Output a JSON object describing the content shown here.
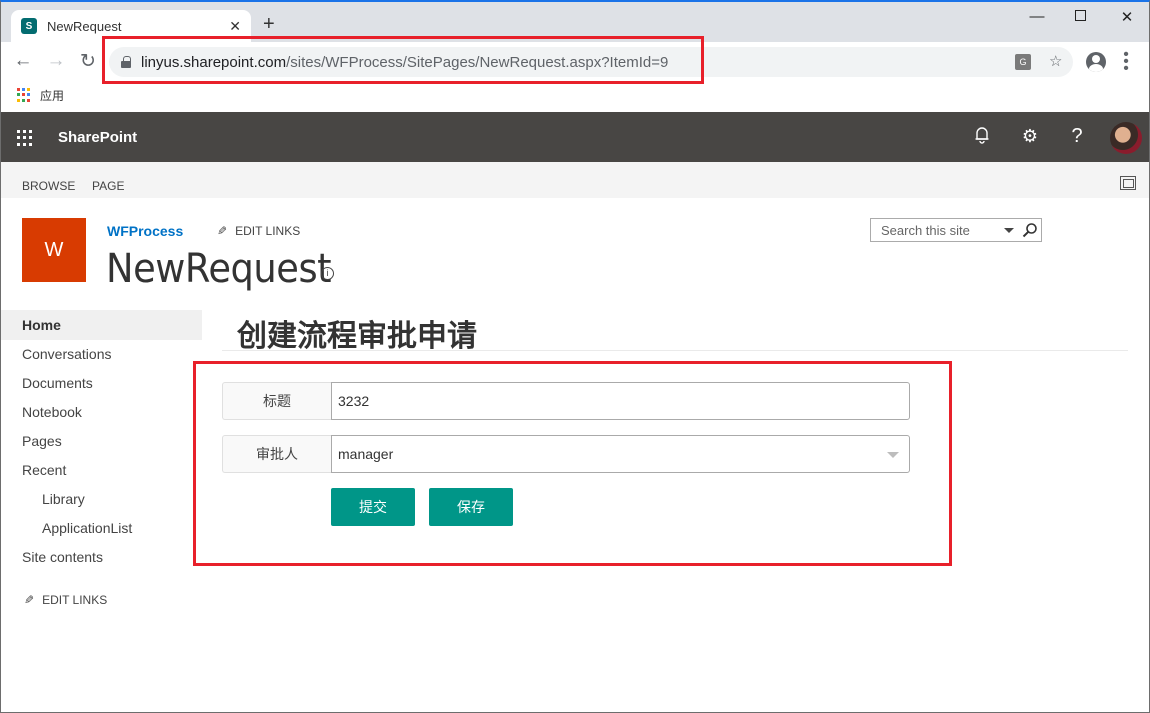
{
  "browser": {
    "tab_title": "NewRequest",
    "tab_close": "✕",
    "new_tab": "+",
    "url_host": "linyus.sharepoint.com",
    "url_path": "/sites/WFProcess/SitePages/NewRequest.aspx?ItemId=9",
    "bookmarks_apps_label": "应用",
    "window_controls": {
      "minimize": "—",
      "close": "✕"
    },
    "nav": {
      "back": "←",
      "forward": "→",
      "reload": "↻"
    },
    "icons": {
      "star": "☆",
      "menu": "⋮",
      "translate": "G"
    }
  },
  "suite_bar": {
    "brand": "SharePoint",
    "icons": {
      "bell": "🔔︎",
      "gear": "⚙",
      "help": "?"
    },
    "colors": {
      "background": "#484644"
    }
  },
  "ribbon": {
    "tabs": [
      "BROWSE",
      "PAGE"
    ]
  },
  "site_header": {
    "logo_letter": "W",
    "site_name": "WFProcess",
    "edit_links": "EDIT LINKS",
    "page_title": "NewRequest",
    "info_icon": "i",
    "search_placeholder": "Search this site",
    "colors": {
      "logo": "#d83b01",
      "link": "#0072c6"
    }
  },
  "quick_launch": {
    "items": [
      {
        "label": "Home",
        "selected": true
      },
      {
        "label": "Conversations"
      },
      {
        "label": "Documents"
      },
      {
        "label": "Notebook"
      },
      {
        "label": "Pages"
      },
      {
        "label": "Recent"
      },
      {
        "label": "Library",
        "sub": true
      },
      {
        "label": "ApplicationList",
        "sub": true
      },
      {
        "label": "Site contents"
      }
    ],
    "edit_links": "EDIT LINKS"
  },
  "form": {
    "heading": "创建流程审批申请",
    "fields": [
      {
        "label": "标题",
        "value": "3232",
        "type": "text"
      },
      {
        "label": "审批人",
        "value": "manager",
        "type": "select"
      }
    ],
    "buttons": {
      "submit": "提交",
      "save": "保存"
    },
    "colors": {
      "button": "#009688",
      "annotation": "#e8202a"
    }
  }
}
